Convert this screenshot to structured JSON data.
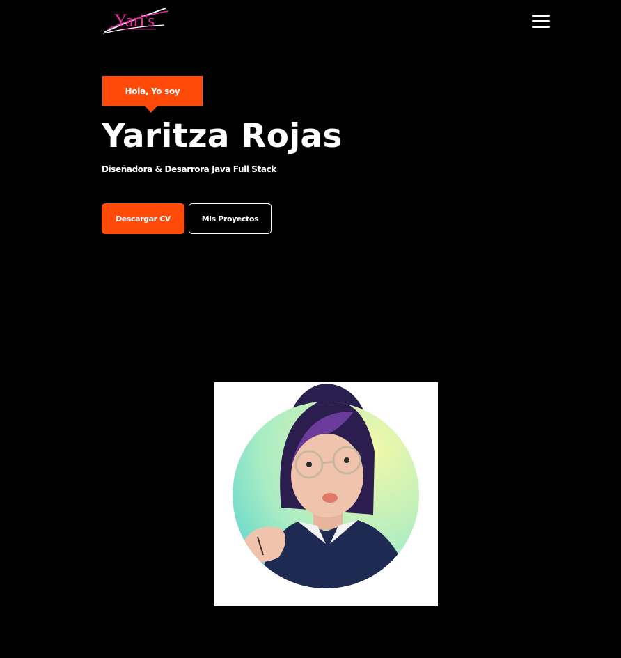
{
  "nav": {
    "logo_text": "Yari's",
    "logo_icon": "brand-logo",
    "menu_icon": "hamburger-menu-icon"
  },
  "hero": {
    "greeting": "Hola, Yo soy",
    "name": "Yaritza Rojas",
    "subtitle": "Diseñadora & Desarrora Java Full Stack",
    "download_cv_label": "Descargar CV",
    "projects_label": "Mis Proyectos"
  },
  "colors": {
    "background": "#000000",
    "accent": "#ff4a0a",
    "text": "#ffffff",
    "logo_pink": "#e0309b"
  },
  "profile": {
    "photo_icon": "profile-photo"
  }
}
